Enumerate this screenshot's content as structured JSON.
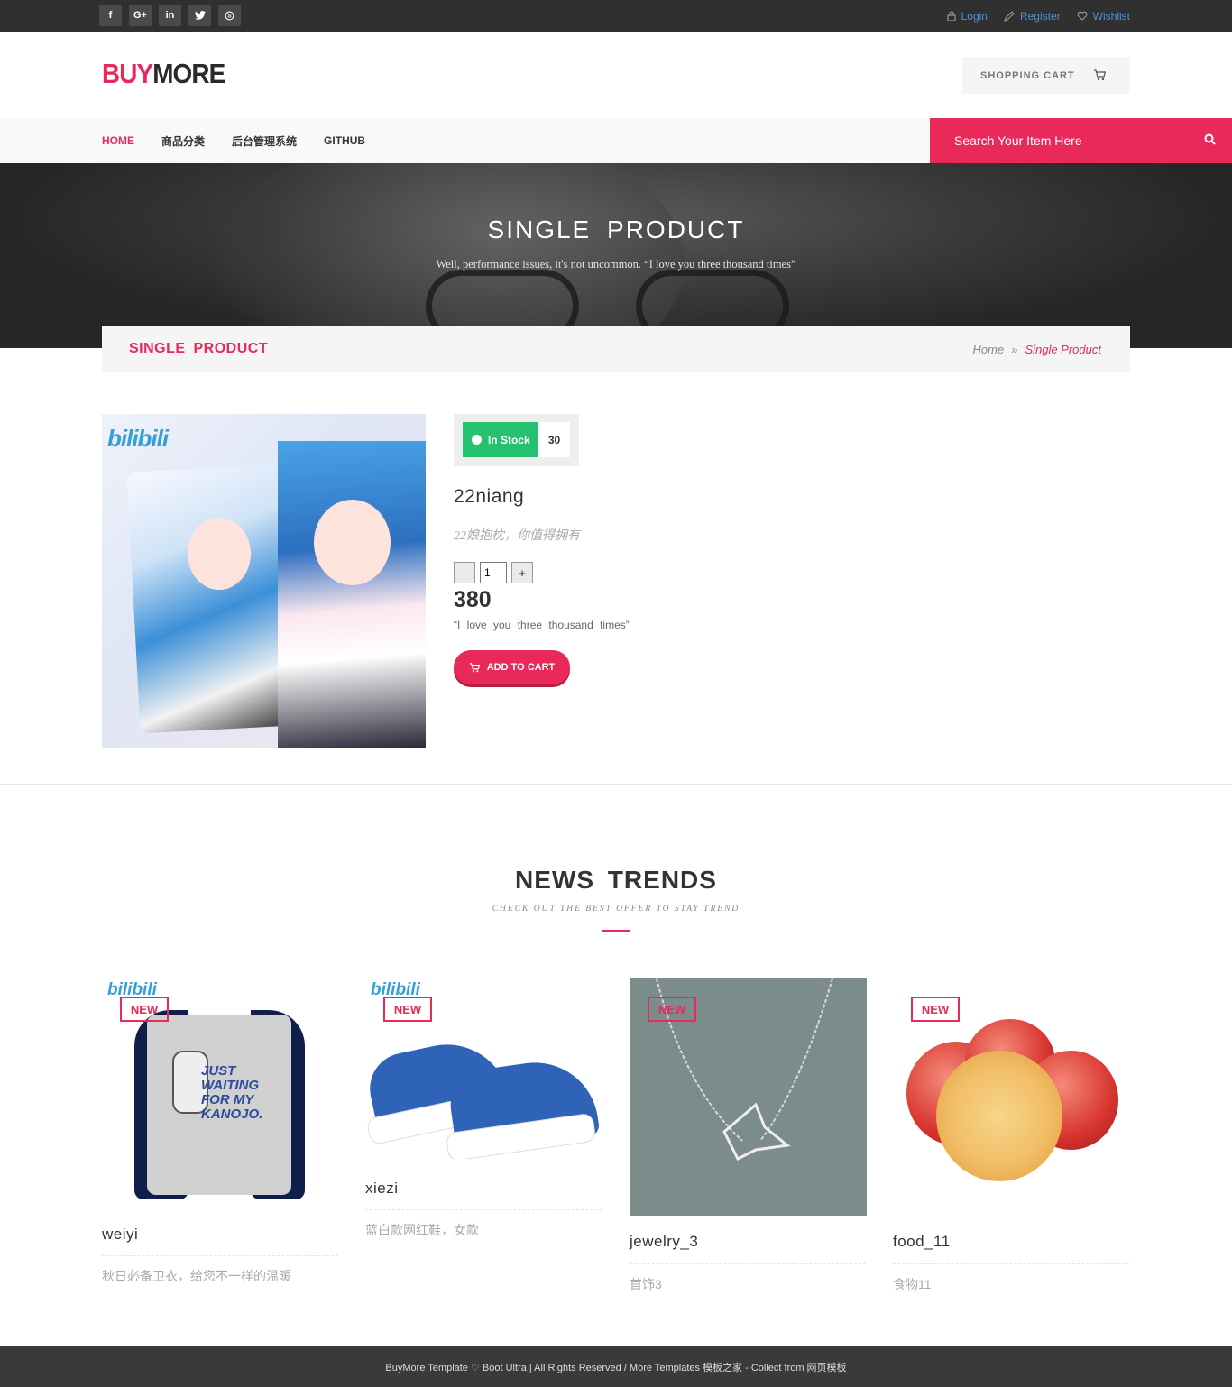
{
  "topbar": {
    "social": [
      "f",
      "G+",
      "in",
      "t",
      "s"
    ],
    "social_icons": [
      "facebook-icon",
      "google-plus-icon",
      "linkedin-icon",
      "twitter-icon",
      "skype-icon"
    ],
    "login": "Login",
    "register": "Register",
    "wishlist": "Wishlist"
  },
  "header": {
    "logo_a": "BUY",
    "logo_b": "MORE",
    "cart_label": "SHOPPING CART"
  },
  "nav": {
    "items": [
      "HOME",
      "商品分类",
      "后台管理系统",
      "GITHUB"
    ],
    "search_placeholder": "Search Your Item Here"
  },
  "hero": {
    "title": "SINGLE PRODUCT",
    "subtitle": "Well, performance issues, it's not uncommon. “I love you three thousand times”"
  },
  "breadcrumb": {
    "title": "SINGLE PRODUCT",
    "home": "Home",
    "sep": "»",
    "current": "Single Product"
  },
  "product": {
    "image_label": "bilibili",
    "stock_label": "In Stock",
    "stock_count": "30",
    "name": "22niang",
    "description": "22娘抱枕，你值得拥有",
    "qty_minus": "-",
    "qty_value": "1",
    "qty_plus": "+",
    "price": "380",
    "quote": "“I love you three thousand times”",
    "add_to_cart": "ADD TO CART"
  },
  "trends": {
    "title": "NEWS TRENDS",
    "subtitle": "CHECK OUT THE BEST OFFER TO STAY TREND",
    "badge": "NEW",
    "items": [
      {
        "name": "weiyi",
        "desc": "秋日必备卫衣，给您不一样的温暖"
      },
      {
        "name": "xiezi",
        "desc": "蓝白款网红鞋，女款"
      },
      {
        "name": "jewelry_3",
        "desc": "首饰3"
      },
      {
        "name": "food_11",
        "desc": "食物11"
      }
    ]
  },
  "footer": {
    "text": "BuyMore Template ♡ Boot Ultra | All Rights Reserved / More Templates 模板之家 - Collect from 网页模板"
  },
  "colors": {
    "accent": "#e8295a",
    "stock": "#25c16f",
    "topbar": "#303030",
    "footer": "#3a3a3a"
  }
}
